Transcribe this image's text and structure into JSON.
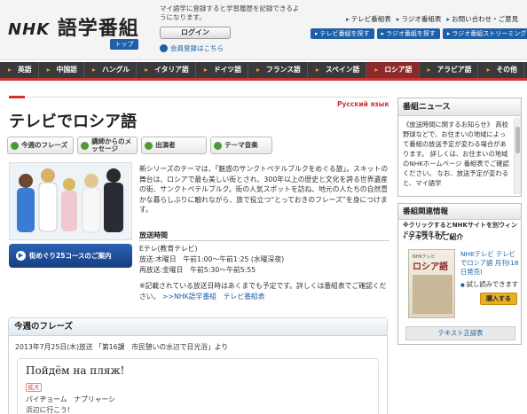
{
  "header": {
    "logo_nhk": "NHK",
    "logo_text": "語学番組",
    "top_badge": "トップ",
    "login_note": "マイ語学に登録すると学習履歴を記録できるようになります。",
    "login_label": "ログイン",
    "register_label": "会員登録はこちら",
    "links": [
      "テレビ番組表",
      "ラジオ番組表",
      "お問い合わせ・ご意見"
    ],
    "buttons": [
      "テレビ番組を探す",
      "ラジオ番組を探す",
      "ラジオ番組ストリーミング"
    ]
  },
  "lang_nav": {
    "items": [
      "英語",
      "中国語",
      "ハングル",
      "イタリア語",
      "ドイツ語",
      "フランス語",
      "スペイン語",
      "ロシア語",
      "アラビア語",
      "その他"
    ],
    "active_index": 7
  },
  "page": {
    "lang_native": "Русский язык",
    "title": "テレビでロシア語",
    "tabs": [
      "今週のフレーズ",
      "講師からのメッセージ",
      "出演者",
      "テーマ音楽"
    ],
    "tour_button": "街めぐり25コースのご案内",
    "intro": "新シリーズのテーマは、「魅惑のサンクトペテルブルクをめぐる旅」。スキットの舞台は、ロシアで最も美しい街とされ、300年以上の歴史と文化を誇る世界遺産の街、サンクトペテルブルク。街の人気スポットを訪ね、地元の人たちの自然豊かな暮らしぶりに触れながら、旅で役立つ“とっておきのフレーズ”を身につけます。",
    "broadcast_heading": "放送時間",
    "broadcast_lines": [
      "Eテレ(教育テレビ)",
      "放送:木曜日　午前1:00〜午前1:25 (水曜深夜)",
      "再放送:金曜日　午前5:30〜午前5:55"
    ],
    "broadcast_note": "※記載されている放送日時はあくまでも予定です。詳しくは番組表でご確認ください。",
    "broadcast_link": ">>NHK語学番組　テレビ番組表"
  },
  "phrase": {
    "heading": "今週のフレーズ",
    "date": "2013年7月25日(木)放送 「第16課　市民憩いの水辺で日光浴」より",
    "russian": "Пойдём на пляж!",
    "badge": "拡大",
    "reading": "パイヂョーム　ナプリャーシ",
    "meaning": "浜辺に行こう!"
  },
  "news": {
    "title": "番組ニュース",
    "body": "《放送時間に関するお知らせ》 高校野球などで、お住まいの地域によって番組の放送予定が変わる場合があります。 詳しくは、お住まいの地域のNHKホームページ 番組表でご確認ください。 なお、放送予定が変わると、マイ語学"
  },
  "related": {
    "title": "番組関連情報",
    "note": "※クリックするとNHKサイトを別ウィンドウで開きます",
    "textbook_heading": "テキストのご紹介",
    "cover_sub": "NHKテレビ",
    "cover_title": "ロシア語",
    "textbook_name": "NHKテレビ テレビでロシア語 月刊(18日発売)",
    "sample_label": "試し読みできます",
    "buy_label": "購入する",
    "list_label": "テキスト正誤表"
  },
  "colors": {
    "brand_blue": "#1d5fa8",
    "accent_red": "#cc3333",
    "nav_dark": "#3a3a3a",
    "active_lang": "#8a2a2a"
  }
}
